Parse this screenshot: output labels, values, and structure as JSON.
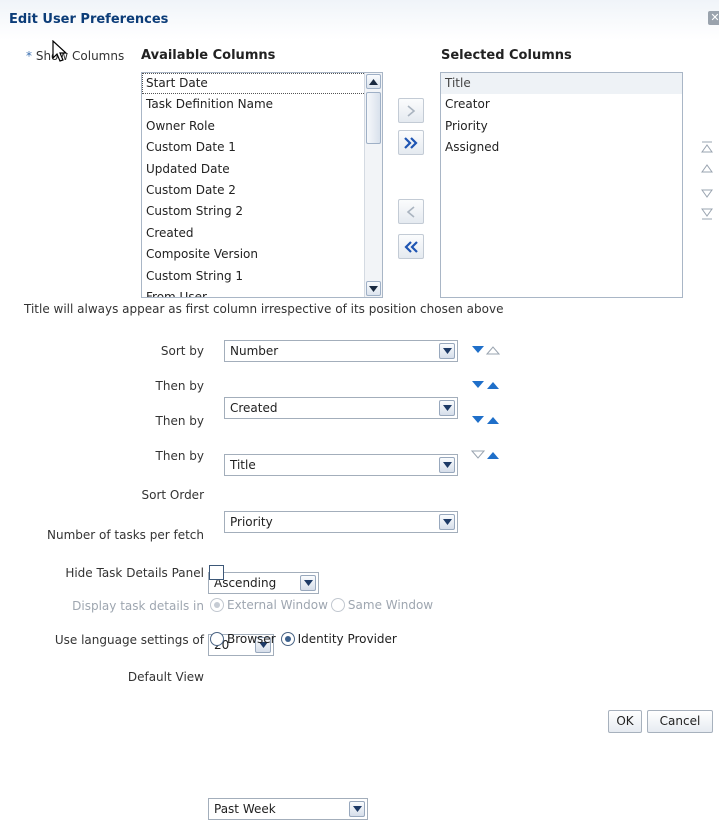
{
  "dialog": {
    "title": "Edit User Preferences",
    "close_icon": "close-icon"
  },
  "columns": {
    "required_marker": "*",
    "label": "Show Columns",
    "available_header": "Available Columns",
    "selected_header": "Selected Columns",
    "available": [
      "Start Date",
      "Task Definition Name",
      "Owner Role",
      "Custom Date 1",
      "Updated Date",
      "Custom Date 2",
      "Custom String 2",
      "Created",
      "Composite Version",
      "Custom String 1",
      "From User"
    ],
    "selected": [
      "Title",
      "Creator",
      "Priority",
      "Assigned"
    ],
    "note": "Title will always appear as first column irrespective of its position chosen above"
  },
  "sorting": [
    {
      "label": "Sort by",
      "value": "Number"
    },
    {
      "label": "Then by",
      "value": "Created"
    },
    {
      "label": "Then by",
      "value": "Title"
    },
    {
      "label": "Then by",
      "value": "Priority"
    }
  ],
  "sort_order": {
    "label": "Sort Order",
    "value": "Ascending"
  },
  "tasks_per_fetch": {
    "label": "Number of tasks per fetch",
    "value": "20"
  },
  "hide_details": {
    "label": "Hide Task Details Panel",
    "checked": false
  },
  "display_details": {
    "label": "Display task details in",
    "options": [
      "External Window",
      "Same Window"
    ],
    "selected": "External Window",
    "disabled": true
  },
  "language": {
    "label": "Use language settings of",
    "options": [
      "Browser",
      "Identity Provider"
    ],
    "selected": "Identity Provider"
  },
  "default_view": {
    "label": "Default View",
    "value": "Past Week"
  },
  "buttons": {
    "ok": "OK",
    "cancel": "Cancel"
  },
  "colors": {
    "title": "#0b3c78",
    "accent_blue": "#1f6fc9",
    "disabled": "#9ea6b0"
  }
}
